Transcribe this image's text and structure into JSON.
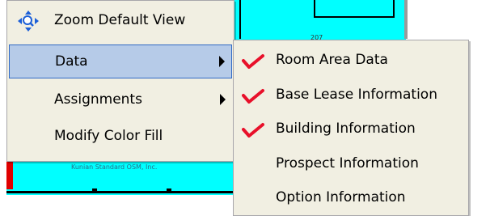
{
  "background": {
    "room_number": "207",
    "faint_text": "Kunian Standard OSM, Inc."
  },
  "menu": {
    "items": [
      {
        "label": "Zoom Default View",
        "icon": "zoom-icon",
        "has_submenu": false
      },
      {
        "label": "Data",
        "has_submenu": true,
        "selected": true
      },
      {
        "label": "Assignments",
        "has_submenu": true
      },
      {
        "label": "Modify Color Fill",
        "has_submenu": false
      }
    ]
  },
  "submenu": {
    "items": [
      {
        "label": "Room Area Data",
        "checked": true
      },
      {
        "label": "Base Lease Information",
        "checked": true
      },
      {
        "label": "Building Information",
        "checked": true
      },
      {
        "label": "Prospect Information",
        "checked": false
      },
      {
        "label": "Option Information",
        "checked": false
      }
    ]
  },
  "colors": {
    "menu_bg": "#f1efe2",
    "highlight": "#b6cbe8",
    "check": "#e8102a",
    "canvas": "#00ffff"
  }
}
